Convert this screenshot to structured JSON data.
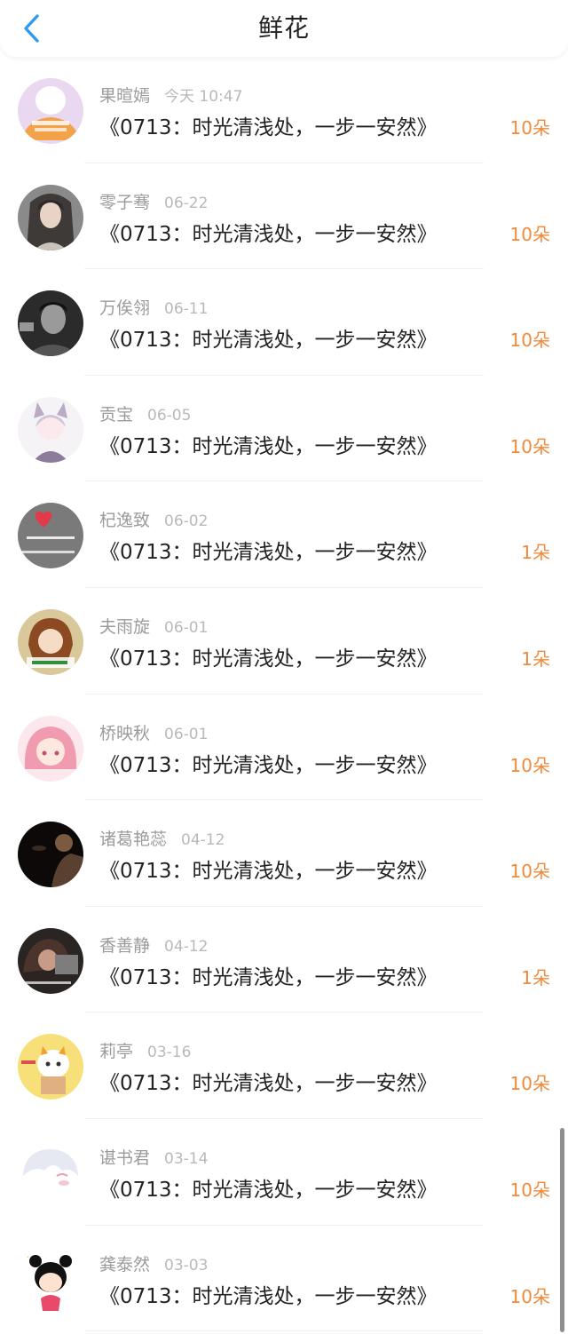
{
  "header": {
    "title": "鲜花",
    "back_icon": "chevron-left-icon",
    "accent_color": "#2f9bf0"
  },
  "colors": {
    "count": "#f08a3a",
    "name": "#9b9b9b",
    "date": "#b9b9b9",
    "content": "#222222"
  },
  "items": [
    {
      "name": "果暄嫣",
      "date": "今天 10:47",
      "content": "《0713：时光清浅处，一步一安然》",
      "count": "10朵"
    },
    {
      "name": "零子骞",
      "date": "06-22",
      "content": "《0713：时光清浅处，一步一安然》",
      "count": "10朵"
    },
    {
      "name": "万俟翎",
      "date": "06-11",
      "content": "《0713：时光清浅处，一步一安然》",
      "count": "10朵"
    },
    {
      "name": "贡宝",
      "date": "06-05",
      "content": "《0713：时光清浅处，一步一安然》",
      "count": "10朵"
    },
    {
      "name": "杞逸致",
      "date": "06-02",
      "content": "《0713：时光清浅处，一步一安然》",
      "count": "1朵"
    },
    {
      "name": "夫雨旋",
      "date": "06-01",
      "content": "《0713：时光清浅处，一步一安然》",
      "count": "1朵"
    },
    {
      "name": "桥映秋",
      "date": "06-01",
      "content": "《0713：时光清浅处，一步一安然》",
      "count": "10朵"
    },
    {
      "name": "诸葛艳蕊",
      "date": "04-12",
      "content": "《0713：时光清浅处，一步一安然》",
      "count": "10朵"
    },
    {
      "name": "香善静",
      "date": "04-12",
      "content": "《0713：时光清浅处，一步一安然》",
      "count": "1朵"
    },
    {
      "name": "莉亭",
      "date": "03-16",
      "content": "《0713：时光清浅处，一步一安然》",
      "count": "10朵"
    },
    {
      "name": "谌书君",
      "date": "03-14",
      "content": "《0713：时光清浅处，一步一安然》",
      "count": "10朵"
    },
    {
      "name": "龚泰然",
      "date": "03-03",
      "content": "《0713：时光清浅处，一步一安然》",
      "count": "10朵"
    }
  ]
}
